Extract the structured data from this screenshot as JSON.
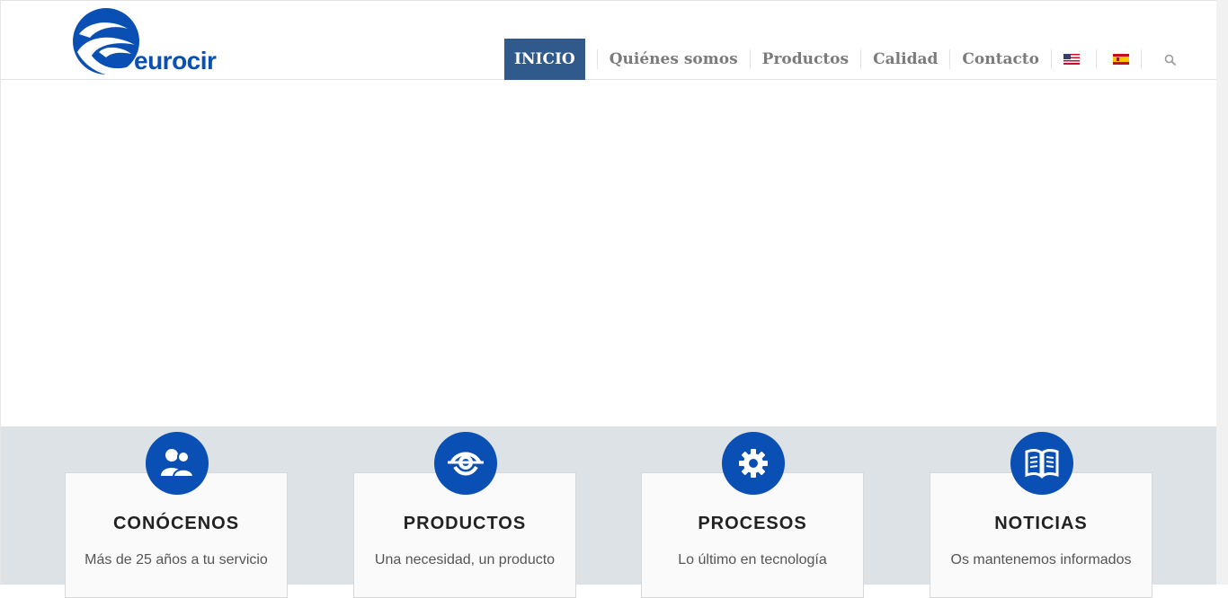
{
  "logo": {
    "text": "eurocir"
  },
  "nav": {
    "items": [
      {
        "label": "INICIO"
      },
      {
        "label": "Quiénes somos"
      },
      {
        "label": "Productos"
      },
      {
        "label": "Calidad"
      },
      {
        "label": "Contacto"
      }
    ],
    "languages": [
      "en-flag-icon",
      "es-flag-icon"
    ],
    "search_icon": "search-icon"
  },
  "features": [
    {
      "title": "CONÓCENOS",
      "subtitle": "Más de 25 años a tu servicio",
      "icon": "users-icon"
    },
    {
      "title": "PRODUCTOS",
      "subtitle": "Una necesidad, un producto",
      "icon": "eye-icon"
    },
    {
      "title": "PROCESOS",
      "subtitle": "Lo último en tecnología",
      "icon": "gear-icon"
    },
    {
      "title": "NOTICIAS",
      "subtitle": "Os mantenemos informados",
      "icon": "book-icon"
    }
  ],
  "colors": {
    "brand": "#0a4fb3",
    "nav_active": "#2f5a8b",
    "features_bg": "#dde2e7"
  }
}
